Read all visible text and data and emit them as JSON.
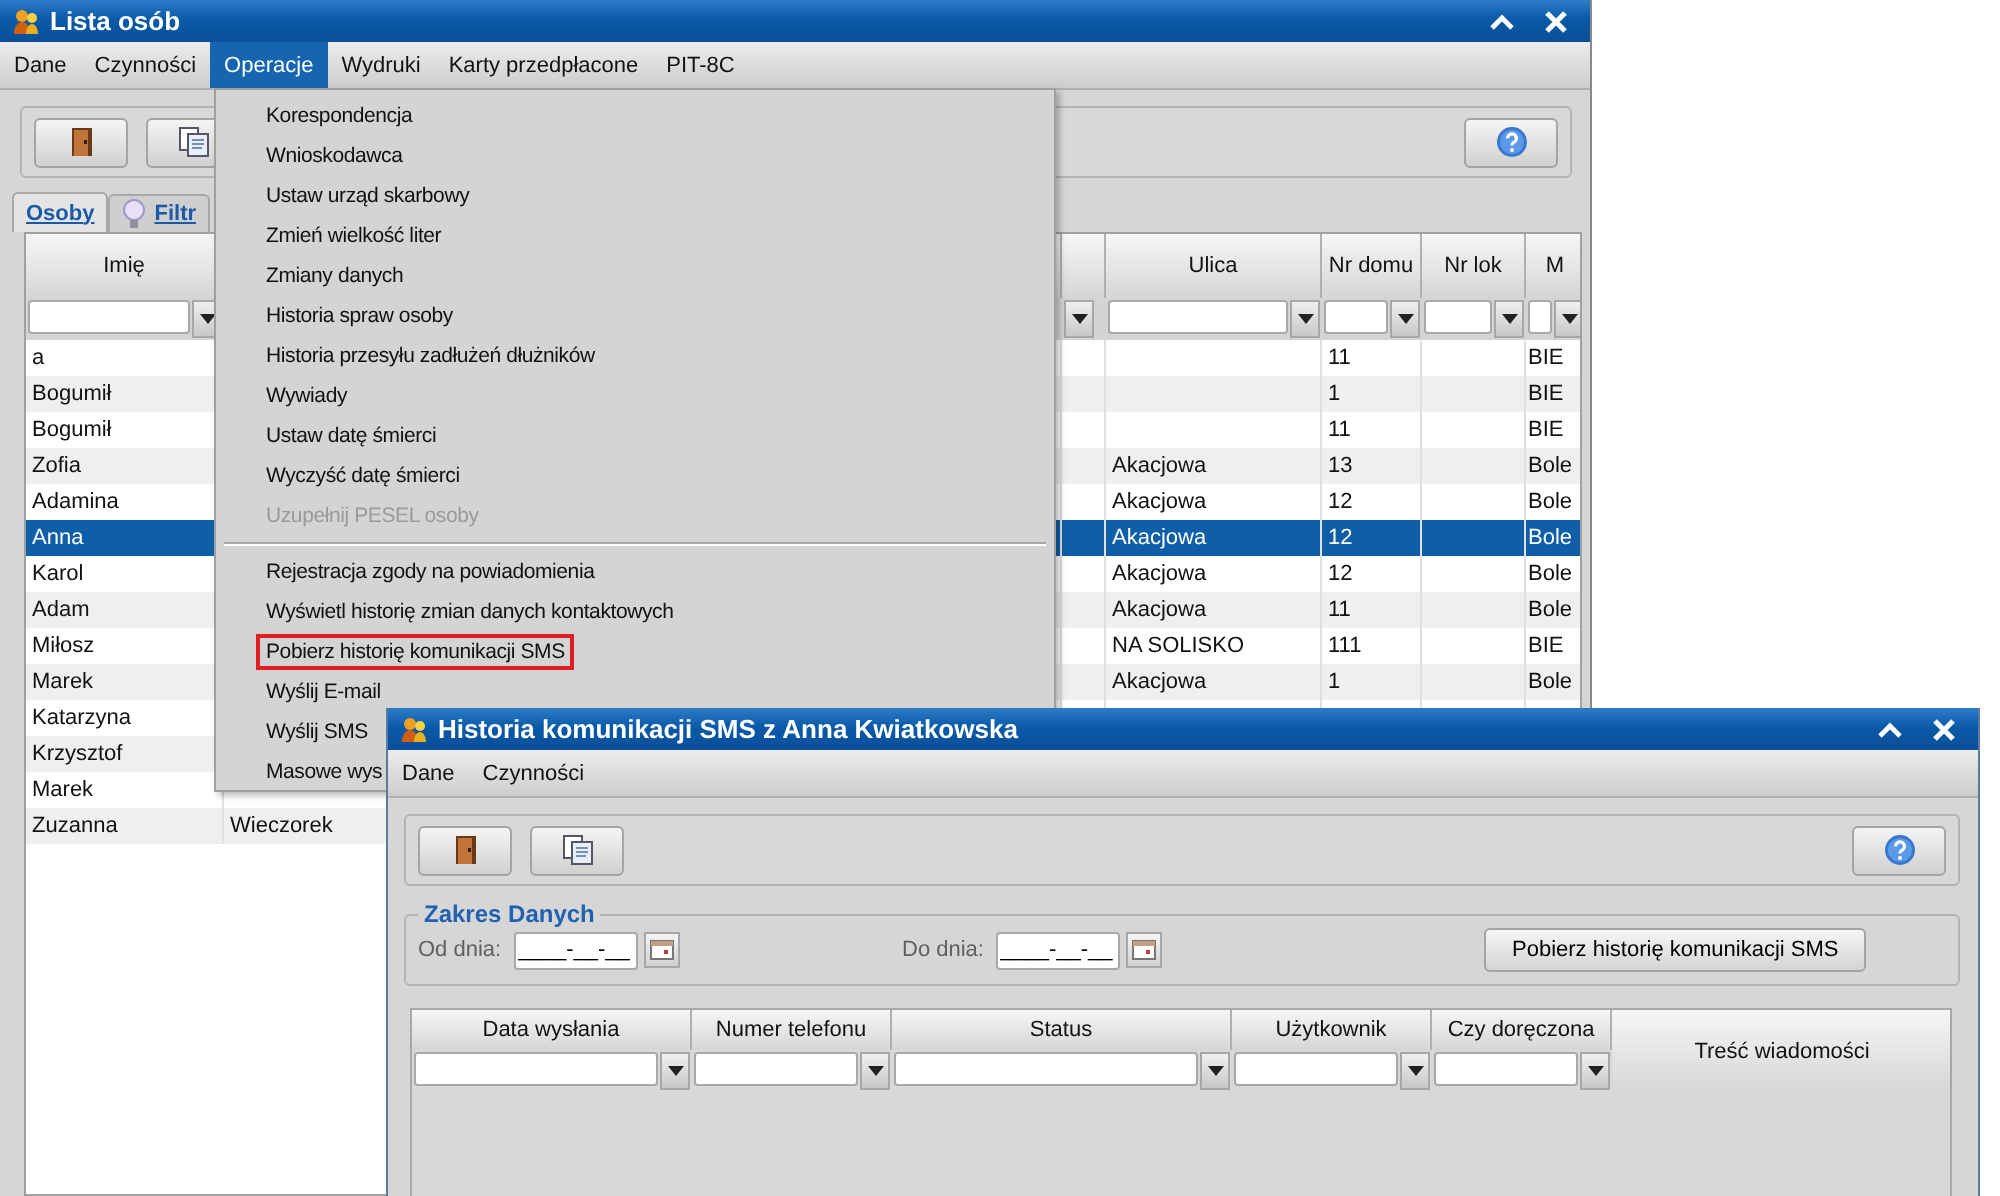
{
  "main_window": {
    "title": "Lista osób",
    "menu": [
      {
        "label": "Dane",
        "selected": false
      },
      {
        "label": "Czynności",
        "selected": false
      },
      {
        "label": "Operacje",
        "selected": true
      },
      {
        "label": "Wydruki",
        "selected": false
      },
      {
        "label": "Karty przedpłacone",
        "selected": false
      },
      {
        "label": "PIT-8C",
        "selected": false
      }
    ],
    "tabs": [
      {
        "label": "Osoby",
        "selected": true,
        "kind": "plain"
      },
      {
        "label": "Filtr",
        "selected": false,
        "kind": "bulb"
      }
    ],
    "table": {
      "columns": [
        "Imię",
        "Ulica",
        "Nr domu",
        "Nr lok",
        "M"
      ],
      "rows": [
        {
          "name": "a",
          "house_no": "11",
          "column_7": "BIE",
          "selected": false
        },
        {
          "name": "Bogumił",
          "house_no": "1",
          "column_7": "BIE",
          "selected": false
        },
        {
          "name": "Bogumił",
          "house_no": "11",
          "column_7": "BIE",
          "selected": false
        },
        {
          "name": "Zofia",
          "street": "Akacjowa",
          "house_no": "13",
          "column_7": "Bole",
          "selected": false
        },
        {
          "name": "Adamina",
          "street": "Akacjowa",
          "house_no": "12",
          "column_7": "Bole",
          "selected": false
        },
        {
          "name": "Anna",
          "street": "Akacjowa",
          "house_no": "12",
          "column_7": "Bole",
          "selected": true
        },
        {
          "name": "Karol",
          "street": "Akacjowa",
          "house_no": "12",
          "column_7": "Bole",
          "selected": false
        },
        {
          "name": "Adam",
          "street": "Akacjowa",
          "house_no": "11",
          "column_7": "Bole",
          "selected": false
        },
        {
          "name": "Miłosz",
          "street": "NA SOLISKO",
          "house_no": "111",
          "column_7": "BIE",
          "selected": false
        },
        {
          "name": "Marek",
          "street": "Akacjowa",
          "house_no": "1",
          "column_7": "Bole",
          "selected": false
        },
        {
          "name": "Katarzyna",
          "selected": false
        },
        {
          "name": "Krzysztof",
          "selected": false
        },
        {
          "name": "Marek",
          "selected": false
        },
        {
          "name": "Zuzanna",
          "column_2": "Wieczorek",
          "selected": false
        }
      ]
    }
  },
  "dropdown_menu": [
    {
      "kind": "item",
      "label": "Korespondencja",
      "disabled": false,
      "outlined": false
    },
    {
      "kind": "item",
      "label": "Wnioskodawca",
      "disabled": false,
      "outlined": false
    },
    {
      "kind": "item",
      "label": "Ustaw urząd skarbowy",
      "disabled": false,
      "outlined": false
    },
    {
      "kind": "item",
      "label": "Zmień wielkość liter",
      "disabled": false,
      "outlined": false
    },
    {
      "kind": "item",
      "label": "Zmiany danych",
      "disabled": false,
      "outlined": false
    },
    {
      "kind": "item",
      "label": "Historia spraw osoby",
      "disabled": false,
      "outlined": false
    },
    {
      "kind": "item",
      "label": "Historia przesyłu zadłużeń dłużników",
      "disabled": false,
      "outlined": false
    },
    {
      "kind": "item",
      "label": "Wywiady",
      "disabled": false,
      "outlined": false
    },
    {
      "kind": "item",
      "label": "Ustaw datę śmierci",
      "disabled": false,
      "outlined": false
    },
    {
      "kind": "item",
      "label": "Wyczyść datę śmierci",
      "disabled": false,
      "outlined": false
    },
    {
      "kind": "item",
      "label": "Uzupełnij PESEL osoby",
      "disabled": true,
      "outlined": false
    },
    {
      "kind": "separator"
    },
    {
      "kind": "item",
      "label": "Rejestracja zgody na powiadomienia",
      "disabled": false,
      "outlined": false
    },
    {
      "kind": "item",
      "label": "Wyświetl historię zmian danych kontaktowych",
      "disabled": false,
      "outlined": false
    },
    {
      "kind": "item",
      "label": "Pobierz historię komunikacji SMS",
      "disabled": false,
      "outlined": true
    },
    {
      "kind": "item",
      "label": "Wyślij E-mail",
      "disabled": false,
      "outlined": false
    },
    {
      "kind": "item",
      "label": "Wyślij SMS",
      "disabled": false,
      "outlined": false
    },
    {
      "kind": "item",
      "label": "Masowe wys",
      "disabled": false,
      "outlined": false
    }
  ],
  "sms_window": {
    "title": "Historia komunikacji SMS z Anna Kwiatkowska",
    "menu": [
      "Dane",
      "Czynności"
    ],
    "date_range": {
      "title": "Zakres Danych",
      "from_label": "Od dnia:",
      "from_value": "____-__-__",
      "to_label": "Do dnia:",
      "to_value": "____-__-__",
      "fetch_button": "Pobierz historię komunikacji SMS"
    },
    "table": {
      "columns": [
        {
          "header": "Data wysłania",
          "filter": true
        },
        {
          "header": "Numer telefonu",
          "filter": true
        },
        {
          "header": "Status",
          "filter": true
        },
        {
          "header": "Użytkownik",
          "filter": true
        },
        {
          "header": "Czy doręczona",
          "filter": true
        },
        {
          "header": "Treść wiadomości",
          "filter": false
        }
      ]
    }
  }
}
